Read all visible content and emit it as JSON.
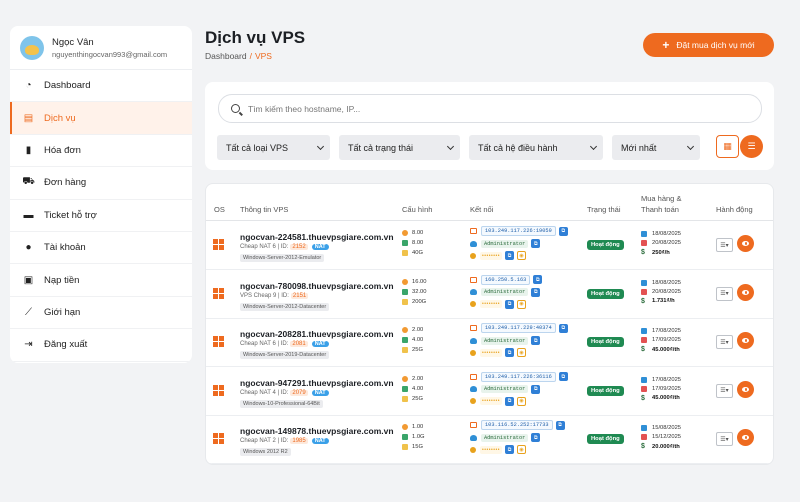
{
  "profile": {
    "name": "Ngọc Vân",
    "email": "nguyenthingocvan993@gmail.com"
  },
  "sidebar": {
    "items": [
      {
        "label": "Dashboard",
        "icon": "dashboard-icon",
        "active": false
      },
      {
        "label": "Dịch vụ",
        "icon": "server-icon",
        "active": true
      },
      {
        "label": "Hóa đơn",
        "icon": "invoice-icon",
        "active": false
      },
      {
        "label": "Đơn hàng",
        "icon": "cart-icon",
        "active": false
      },
      {
        "label": "Ticket hỗ trợ",
        "icon": "ticket-icon",
        "active": false
      },
      {
        "label": "Tài khoản",
        "icon": "user-icon",
        "active": false
      },
      {
        "label": "Nạp tiền",
        "icon": "wallet-icon",
        "active": false
      },
      {
        "label": "Giới hạn",
        "icon": "chart-line-icon",
        "active": false
      },
      {
        "label": "Đăng xuất",
        "icon": "logout-icon",
        "active": false
      }
    ]
  },
  "header": {
    "title": "Dịch vụ VPS",
    "breadcrumb": {
      "home": "Dashboard",
      "sep": "/",
      "current": "VPS"
    },
    "order_button": "Đặt mua dịch vụ mới"
  },
  "filters": {
    "search_placeholder": "Tìm kiếm theo hostname, IP...",
    "type": "Tất cả loại VPS",
    "status": "Tất cả trạng thái",
    "os": "Tất cả hệ điều hành",
    "sort": "Mới nhất"
  },
  "table": {
    "headers": {
      "os": "OS",
      "info": "Thông tin VPS",
      "config": "Cấu hình",
      "connect": "Kết nối",
      "status": "Trạng thái",
      "purchase_line1": "Mua hàng &",
      "purchase_line2": "Thanh toán",
      "actions": "Hành động"
    },
    "rows": [
      {
        "hostname": "ngocvan-224581.thuevpsgiare.com.vn",
        "plan": "Cheap NAT 6 | ID:",
        "id": "2152",
        "nat": "NAT",
        "os": "Windows-Server-2012-Emulator",
        "cpu": "8.00",
        "ram": "8.00",
        "disk": "40G",
        "ip": "103.249.117.226:19059",
        "user": "Administrator",
        "password": "••••••••",
        "status": "Hoạt động",
        "date1": "18/08/2025",
        "date2": "20/08/2025",
        "price": "250₫/h"
      },
      {
        "hostname": "ngocvan-780098.thuevpsgiare.com.vn",
        "plan": "VPS Cheap 9 | ID:",
        "id": "2151",
        "nat": "",
        "os": "Windows-Server-2012-Datacenter",
        "cpu": "16.00",
        "ram": "32.00",
        "disk": "200G",
        "ip": "160.250.5.163",
        "user": "Administrator",
        "password": "••••••••",
        "status": "Hoạt động",
        "date1": "18/08/2025",
        "date2": "20/08/2025",
        "price": "1.731₫/h"
      },
      {
        "hostname": "ngocvan-208281.thuevpsgiare.com.vn",
        "plan": "Cheap NAT 6 | ID:",
        "id": "2081",
        "nat": "NAT",
        "os": "Windows-Server-2019-Datacenter",
        "cpu": "2.00",
        "ram": "4.00",
        "disk": "25G",
        "ip": "103.249.117.229:40374",
        "user": "Administrator",
        "password": "••••••••",
        "status": "Hoạt động",
        "date1": "17/08/2025",
        "date2": "17/09/2025",
        "price": "45.000₫/th"
      },
      {
        "hostname": "ngocvan-947291.thuevpsgiare.com.vn",
        "plan": "Cheap NAT 4 | ID:",
        "id": "2079",
        "nat": "NAT",
        "os": "Windows-10-Professional-64Bit",
        "cpu": "2.00",
        "ram": "4.00",
        "disk": "25G",
        "ip": "103.249.117.226:36116",
        "user": "Administrator",
        "password": "••••••••",
        "status": "Hoạt động",
        "date1": "17/08/2025",
        "date2": "17/09/2025",
        "price": "45.000₫/th"
      },
      {
        "hostname": "ngocvan-149878.thuevpsgiare.com.vn",
        "plan": "Cheap NAT 2 | ID:",
        "id": "1985",
        "nat": "NAT",
        "os": "Windows 2012 R2",
        "cpu": "1.00",
        "ram": "1.0G",
        "disk": "15G",
        "ip": "103.116.52.252:17733",
        "user": "Administrator",
        "password": "••••••••",
        "status": "Hoạt động",
        "date1": "15/08/2025",
        "date2": "15/12/2025",
        "price": "20.000₫/th"
      }
    ]
  },
  "colors": {
    "accent": "#ee6a1f",
    "status_active": "#1f8a52",
    "link_blue": "#1d5da8"
  }
}
